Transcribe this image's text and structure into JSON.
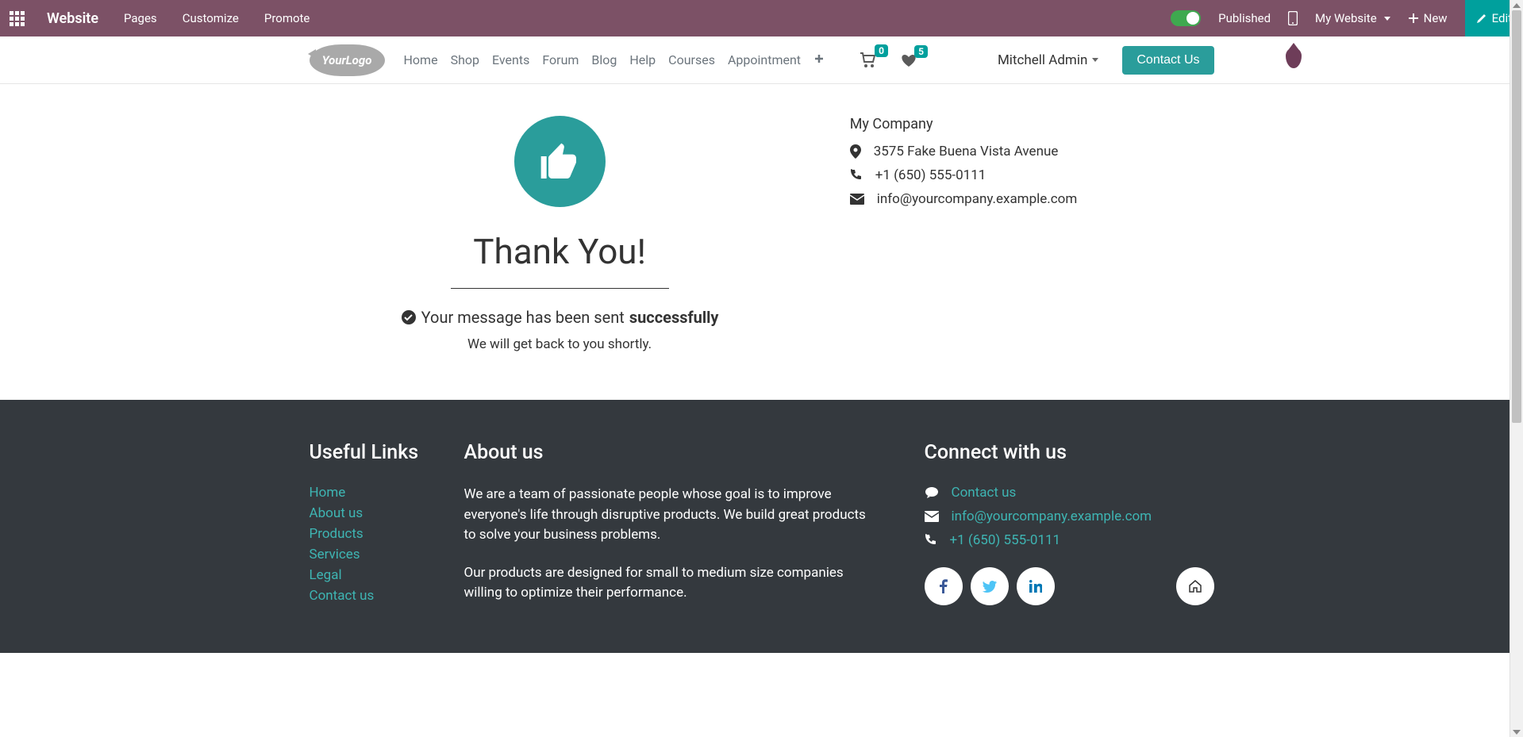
{
  "admin_bar": {
    "brand": "Website",
    "menu": [
      "Pages",
      "Customize",
      "Promote"
    ],
    "published": "Published",
    "my_website": "My Website",
    "new_label": "New",
    "edit_label": "Edit"
  },
  "site_nav": {
    "logo_text": "YourLogo",
    "menu": [
      "Home",
      "Shop",
      "Events",
      "Forum",
      "Blog",
      "Help",
      "Courses",
      "Appointment"
    ],
    "cart_count": "0",
    "wishlist_count": "5",
    "user_name": "Mitchell Admin",
    "contact_btn": "Contact Us"
  },
  "thankyou": {
    "title": "Thank You!",
    "msg_prefix": "Your message has been sent ",
    "msg_strong": "successfully",
    "shortly": "We will get back to you shortly."
  },
  "company": {
    "name": "My Company",
    "address": "3575 Fake Buena Vista Avenue",
    "phone": "+1 (650) 555-0111",
    "email": "info@yourcompany.example.com"
  },
  "footer": {
    "useful_links_title": "Useful Links",
    "useful_links": [
      "Home",
      "About us",
      "Products",
      "Services",
      "Legal",
      "Contact us"
    ],
    "about_title": "About us",
    "about_p1": "We are a team of passionate people whose goal is to improve everyone's life through disruptive products. We build great products to solve your business problems.",
    "about_p2": "Our products are designed for small to medium size companies willing to optimize their performance.",
    "connect_title": "Connect with us",
    "connect_contact": "Contact us",
    "connect_email": "info@yourcompany.example.com",
    "connect_phone": "+1 (650) 555-0111"
  }
}
